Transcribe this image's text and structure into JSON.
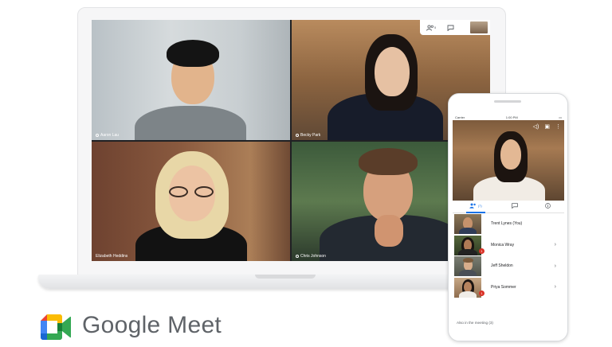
{
  "meeting": {
    "participants_grid": [
      {
        "name": "Aaron Lau"
      },
      {
        "name": "Becky Park"
      },
      {
        "name": "Elizabeth Heddins"
      },
      {
        "name": "Chris Johnson"
      }
    ],
    "toolbar": {
      "people_count": "5"
    }
  },
  "phone": {
    "status": {
      "carrier": "Carrier",
      "time": "1:00 PM"
    },
    "tabs": {
      "people_count": "(7)"
    },
    "participants": [
      {
        "name": "Trent Lynes (You)",
        "has_chevron": false,
        "badge": ""
      },
      {
        "name": "Monica Wray",
        "has_chevron": true,
        "badge": "1"
      },
      {
        "name": "Jeff Sheldon",
        "has_chevron": true,
        "badge": ""
      },
      {
        "name": "Priya Sommer",
        "has_chevron": true,
        "badge": "1"
      }
    ],
    "also_in_meeting": "Also in the meeting   (3)"
  },
  "brand": {
    "name": "Google Meet",
    "colors": {
      "blue": "#4285f4",
      "red": "#ea4335",
      "yellow": "#fbbc04",
      "green": "#34a853",
      "dark_green": "#188038"
    }
  }
}
